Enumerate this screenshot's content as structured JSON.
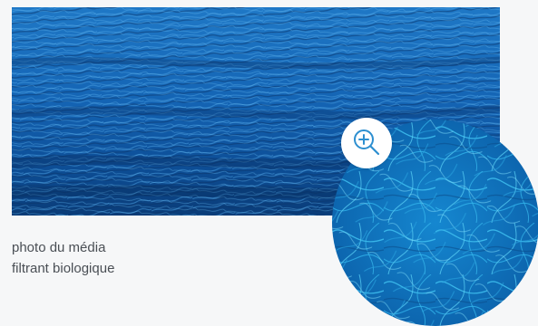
{
  "media_photo": {
    "alt": "photo du média filtrant biologique"
  },
  "caption": {
    "line1": "photo du média",
    "line2": "filtrant biologique"
  },
  "zoom": {
    "icon": "magnifier-plus-icon",
    "image_alt": "photo du média filtrant biologique"
  },
  "colors": {
    "page_background": "#f6f7f8",
    "media_blue_dark": "#0b3f7a",
    "media_blue": "#1a6fc0",
    "fibre_cyan": "#29aae2",
    "icon_blue": "#2d8fd0",
    "caption_text": "#4a4f55"
  }
}
